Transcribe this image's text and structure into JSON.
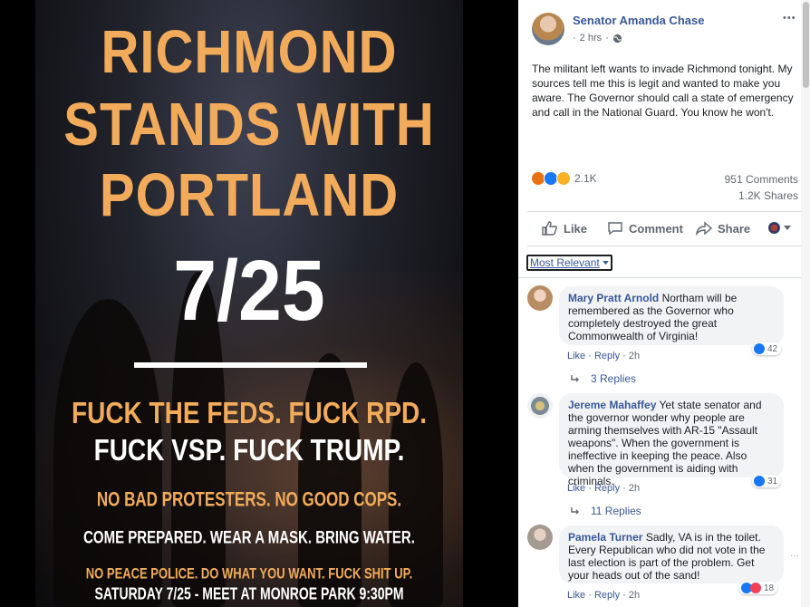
{
  "poster": {
    "line1": "RICHMOND",
    "line2": "STANDS WITH",
    "line3": "PORTLAND",
    "date": "7/25",
    "slogan1": "FUCK THE FEDS. FUCK RPD.",
    "slogan2": "FUCK VSP. FUCK TRUMP.",
    "slogan3": "NO BAD PROTESTERS. NO GOOD COPS.",
    "slogan4": "COME PREPARED. WEAR A MASK. BRING WATER.",
    "slogan5": "NO PEACE POLICE. DO WHAT YOU WANT. FUCK SHIT UP.",
    "slogan6": "SATURDAY 7/25 - MEET AT MONROE PARK 9:30PM"
  },
  "post": {
    "author": "Senator Amanda Chase",
    "time": "2 hrs",
    "more_label": "•••",
    "text": "The militant left wants to invade Richmond tonight. My sources tell me this is legit and wanted to make you aware. The Governor should call a state of emergency and call in the National Guard. You know he won't.",
    "reaction_count": "2.1K",
    "comments_count": "951 Comments",
    "shares_count": "1.2K Shares"
  },
  "actions": {
    "like": "Like",
    "comment": "Comment",
    "share": "Share"
  },
  "filter": {
    "label": "Most Relevant"
  },
  "comments": [
    {
      "name": "Mary Pratt Arnold",
      "text": "Northam will be remembered as the Governor who completely destroyed the great Commonwealth of Virginia!",
      "like": "Like",
      "reply": "Reply",
      "time": "2h",
      "reactions": "42",
      "replies": "3 Replies"
    },
    {
      "name": "Jereme Mahaffey",
      "text": "Yet state senator and the governor wonder why people are arming themselves with AR-15 \"Assault weapons\". When the government is ineffective in keeping the peace. Also when the government is aiding with criminals.",
      "like": "Like",
      "reply": "Reply",
      "time": "2h",
      "reactions": "31",
      "replies": "11 Replies"
    },
    {
      "name": "Pamela Turner",
      "text": "Sadly, VA is in the toilet. Every Republican who did not vote in the last election is part of the problem. Get your heads out of the sand!",
      "like": "Like",
      "reply": "Reply",
      "time": "2h",
      "reactions": "18"
    }
  ],
  "colors": {
    "link": "#385898",
    "poster_orange": "#f2ab5a",
    "like_blue": "#1877f2",
    "angry": "#e9710f",
    "sad": "#f7b125"
  }
}
